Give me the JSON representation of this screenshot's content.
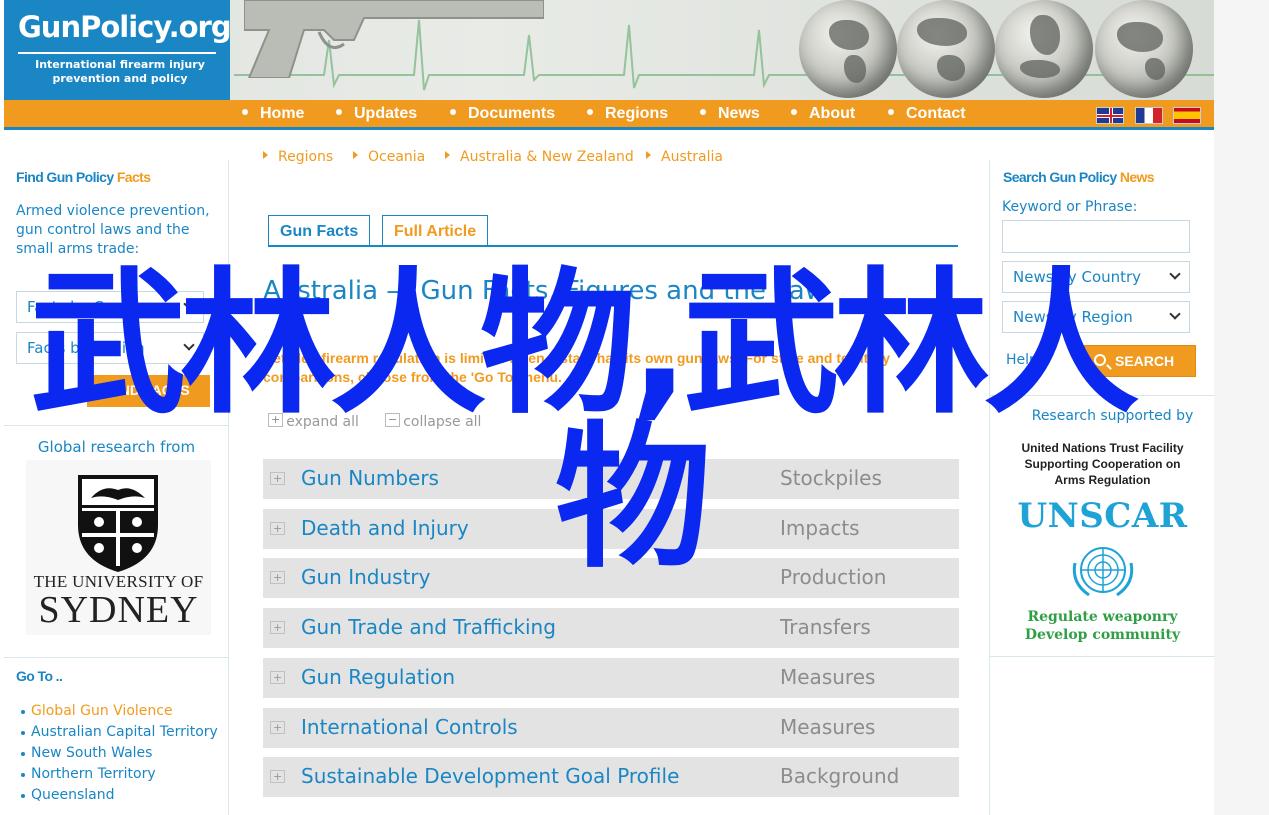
{
  "brand": {
    "logo_title": "GunPolicy.org",
    "logo_subtitle_line1": "International firearm injury",
    "logo_subtitle_line2": "prevention and policy",
    "brand_blue": "#1a86c4",
    "brand_orange": "#f09b1f"
  },
  "nav": {
    "items": [
      {
        "label": "Home"
      },
      {
        "label": "Updates"
      },
      {
        "label": "Documents"
      },
      {
        "label": "Regions"
      },
      {
        "label": "News"
      },
      {
        "label": "About"
      },
      {
        "label": "Contact"
      }
    ],
    "flags": [
      "uk-flag-icon",
      "france-flag-icon",
      "spain-flag-icon"
    ]
  },
  "left": {
    "find_title_main": "Find Gun Policy",
    "find_title_accent": "Facts",
    "description": "Armed violence prevention, gun control laws and the small arms trade:",
    "facts_by_country": "Facts by Country",
    "facts_by_region": "Facts by Region",
    "find_facts_button": "FIND FACTS",
    "global_research": "Global research from",
    "university_line1": "THE UNIVERSITY OF",
    "university_line2": "SYDNEY",
    "goto_title": "Go To ..",
    "goto_items": [
      {
        "label": "Global Gun Violence"
      },
      {
        "label": "Australian Capital Territory"
      },
      {
        "label": "New South Wales"
      },
      {
        "label": "Northern Territory"
      },
      {
        "label": "Queensland"
      }
    ]
  },
  "main": {
    "breadcrumb": [
      {
        "label": "Regions"
      },
      {
        "label": "Oceania"
      },
      {
        "label": "Australia & New Zealand"
      },
      {
        "label": "Australia"
      }
    ],
    "tabs": [
      {
        "label": "Gun Facts"
      },
      {
        "label": "Full Article"
      }
    ],
    "title": "Australia — Gun Facts, Figures and the Law",
    "intro": "Detailed firearm regulation is limited when a state has its own gun laws. For state and territory comparisons, choose from the 'Go To' menu.",
    "expand_all": "expand all",
    "collapse_all": "collapse all",
    "fact_rows": [
      {
        "name": "Gun Numbers",
        "category": "Stockpiles"
      },
      {
        "name": "Death and Injury",
        "category": "Impacts"
      },
      {
        "name": "Gun Industry",
        "category": "Production"
      },
      {
        "name": "Gun Trade and Trafficking",
        "category": "Transfers"
      },
      {
        "name": "Gun Regulation",
        "category": "Measures"
      },
      {
        "name": "International Controls",
        "category": "Measures"
      },
      {
        "name": "Sustainable Development Goal Profile",
        "category": "Background"
      }
    ]
  },
  "right": {
    "title_main": "Search Gun Policy",
    "title_accent": "News",
    "keyword_label": "Keyword or Phrase:",
    "keyword_value": "",
    "news_by_country": "News by Country",
    "news_by_region": "News by Region",
    "help": "Help",
    "search_button": "SEARCH",
    "research_supported": "Research supported by",
    "un_line1": "United Nations Trust Facility",
    "un_line2": "Supporting Cooperation on",
    "un_line3": "Arms Regulation",
    "unscar": "UNSCAR",
    "unscar_tag1": "Regulate weaponry",
    "unscar_tag2": "Develop community"
  },
  "watermark": {
    "line1": "武林人物,武林人",
    "line2": "物",
    "color": "#0a28f0"
  }
}
